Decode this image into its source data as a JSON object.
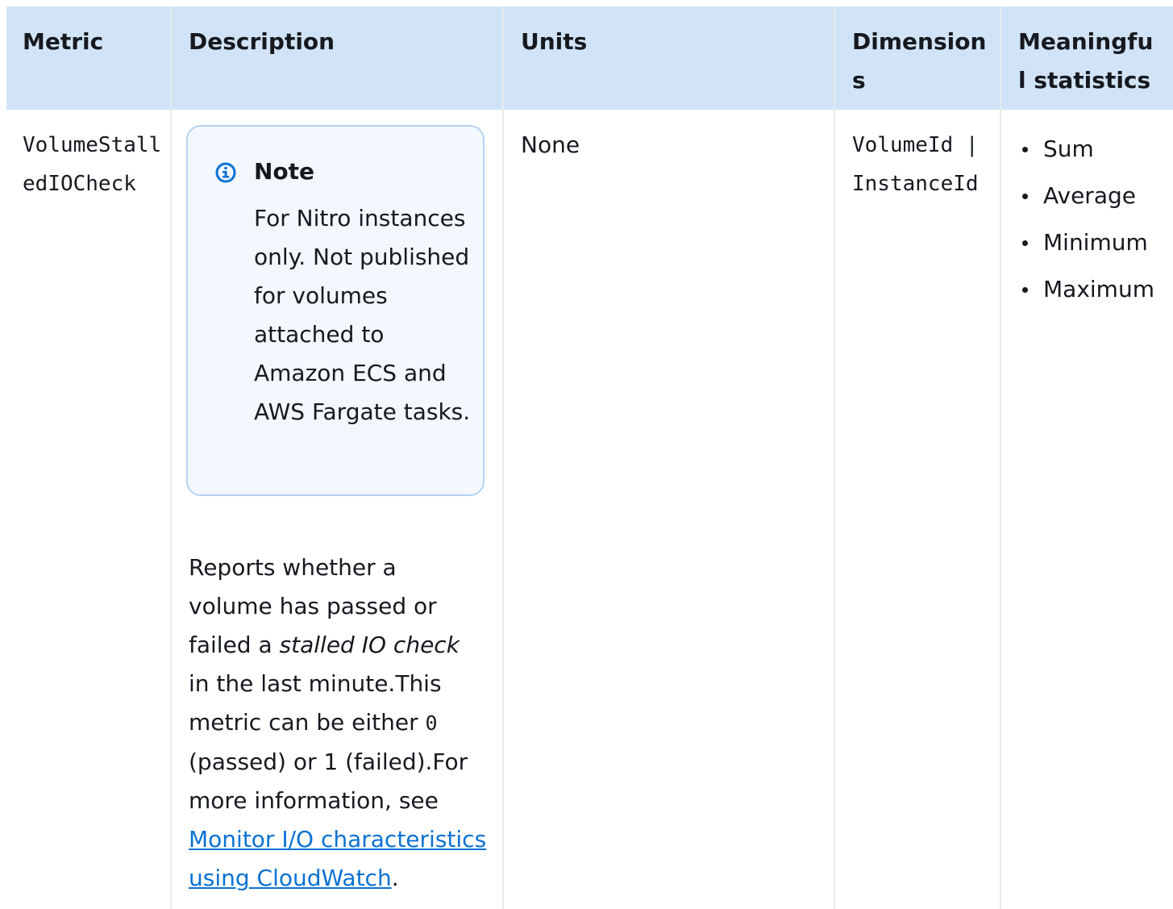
{
  "table": {
    "headers": {
      "metric": "Metric",
      "description": "Description",
      "units": "Units",
      "dimensions": "Dimensions",
      "statistics": "Meaningful statistics"
    },
    "row": {
      "metric": "VolumeStalledIOCheck",
      "note": {
        "title": "Note",
        "body": "For Nitro instances only. Not published for volumes attached to Amazon ECS and AWS Fargate tasks."
      },
      "description": {
        "part1": "Reports whether a volume has passed or failed a ",
        "emphasis": "stalled IO check",
        "part2": " in the last minute.This metric can be either ",
        "code_zero": "0",
        "part3": " (passed) or 1 (failed).For more information, see ",
        "link": "Monitor I/O characteristics using CloudWatch",
        "part4": "."
      },
      "units": "None",
      "dimensions": "VolumeId | InstanceId",
      "statistics": [
        "Sum",
        "Average",
        "Minimum",
        "Maximum"
      ]
    }
  },
  "colors": {
    "header_bg": "#d1e4f7",
    "note_bg": "#f2f8fd",
    "note_border": "#b4d3f0",
    "link": "#0972d3"
  },
  "icons": {
    "note": "info-circle-icon"
  }
}
